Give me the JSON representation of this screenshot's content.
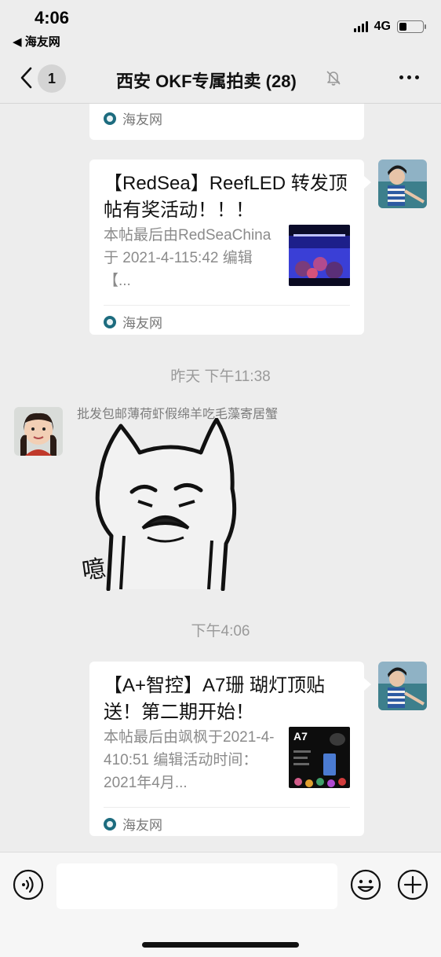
{
  "status_bar": {
    "time": "4:06",
    "back_app": "◀ 海友网",
    "network": "4G"
  },
  "nav": {
    "unread_count": "1",
    "title": "西安 OKF专属拍卖 (28)"
  },
  "messages": {
    "card_top": {
      "source": "海友网"
    },
    "card_redsea": {
      "title": "【RedSea】ReefLED 转发顶帖有奖活动！！！",
      "desc": "本帖最后由RedSeaChina 于 2021-4-115:42 编辑【...",
      "source": "海友网"
    },
    "timestamp_yesterday": "昨天 下午11:38",
    "sender_name": "批发包邮薄荷虾假绵羊吃毛藻寄居蟹",
    "sticker_text": "噫",
    "timestamp_today": "下午4:06",
    "card_a7": {
      "title": "【A+智控】A7珊 瑚灯顶贴送！第二期开始！",
      "desc": "本帖最后由飒枫于2021-4-410:51 编辑活动时间：2021年4月...",
      "thumb_label": "A7",
      "source": "海友网"
    }
  },
  "colors": {
    "background": "#ededed",
    "bubble": "#ffffff",
    "secondary_text": "#8b8b8b",
    "source_icon": "#1d6c7f"
  },
  "icons": [
    "chevron-left-icon",
    "mute-bell-icon",
    "more-dots-icon",
    "voice-icon",
    "emoji-icon",
    "plus-icon",
    "source-logo-icon"
  ]
}
